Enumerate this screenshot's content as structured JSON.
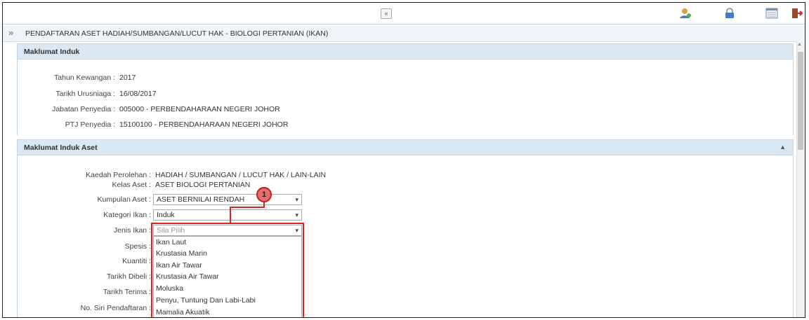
{
  "toolbar": {
    "collapse_glyph": "«",
    "icons": [
      "user-icon",
      "lock-icon",
      "list-icon",
      "logout-icon"
    ]
  },
  "page": {
    "expander_glyph": "»",
    "title": "PENDAFTARAN ASET HADIAH/SUMBANGAN/LUCUT HAK - BIOLOGI PERTANIAN (IKAN)"
  },
  "maklumat_induk": {
    "header": "Maklumat Induk",
    "fields": [
      {
        "label": "Tahun Kewangan :",
        "value": "2017"
      },
      {
        "label": "Tarikh Urusniaga :",
        "value": "16/08/2017"
      },
      {
        "label": "Jabatan Penyedia :",
        "value": "005000 - PERBENDAHARAAN NEGERI JOHOR"
      },
      {
        "label": "PTJ Penyedia :",
        "value": "15100100 - PERBENDAHARAAN NEGERI JOHOR"
      }
    ]
  },
  "maklumat_induk_aset": {
    "header": "Maklumat Induk Aset",
    "kaedah": {
      "label": "Kaedah Perolehan :",
      "value": "HADIAH / SUMBANGAN / LUCUT HAK / LAIN-LAIN"
    },
    "kelas": {
      "label": "Kelas Aset :",
      "value": "ASET BIOLOGI PERTANIAN"
    },
    "kumpulan": {
      "label": "Kumpulan Aset :",
      "value": "ASET BERNILAI RENDAH"
    },
    "kategori": {
      "label": "Kategori Ikan :",
      "value": "Induk"
    },
    "jenis": {
      "label": "Jenis Ikan :",
      "placeholder": "Sila Pilih"
    },
    "spesis": {
      "label": "Spesis :"
    },
    "kuantiti": {
      "label": "Kuantiti :"
    },
    "tarikh_dibeli": {
      "label": "Tarikh Dibeli :"
    },
    "tarikh_terima": {
      "label": "Tarikh Terima :"
    },
    "no_siri": {
      "label": "No. Siri Pendaftaran :"
    },
    "jenis_options": [
      "Ikan Laut",
      "Krustasia Marin",
      "Ikan Air Tawar",
      "Krustasia Air Tawar",
      "Moluska",
      "Penyu, Tuntung Dan Labi-Labi",
      "Mamalia Akuatik"
    ]
  },
  "annotation": {
    "callout_number": "1",
    "color": "#d22222"
  }
}
